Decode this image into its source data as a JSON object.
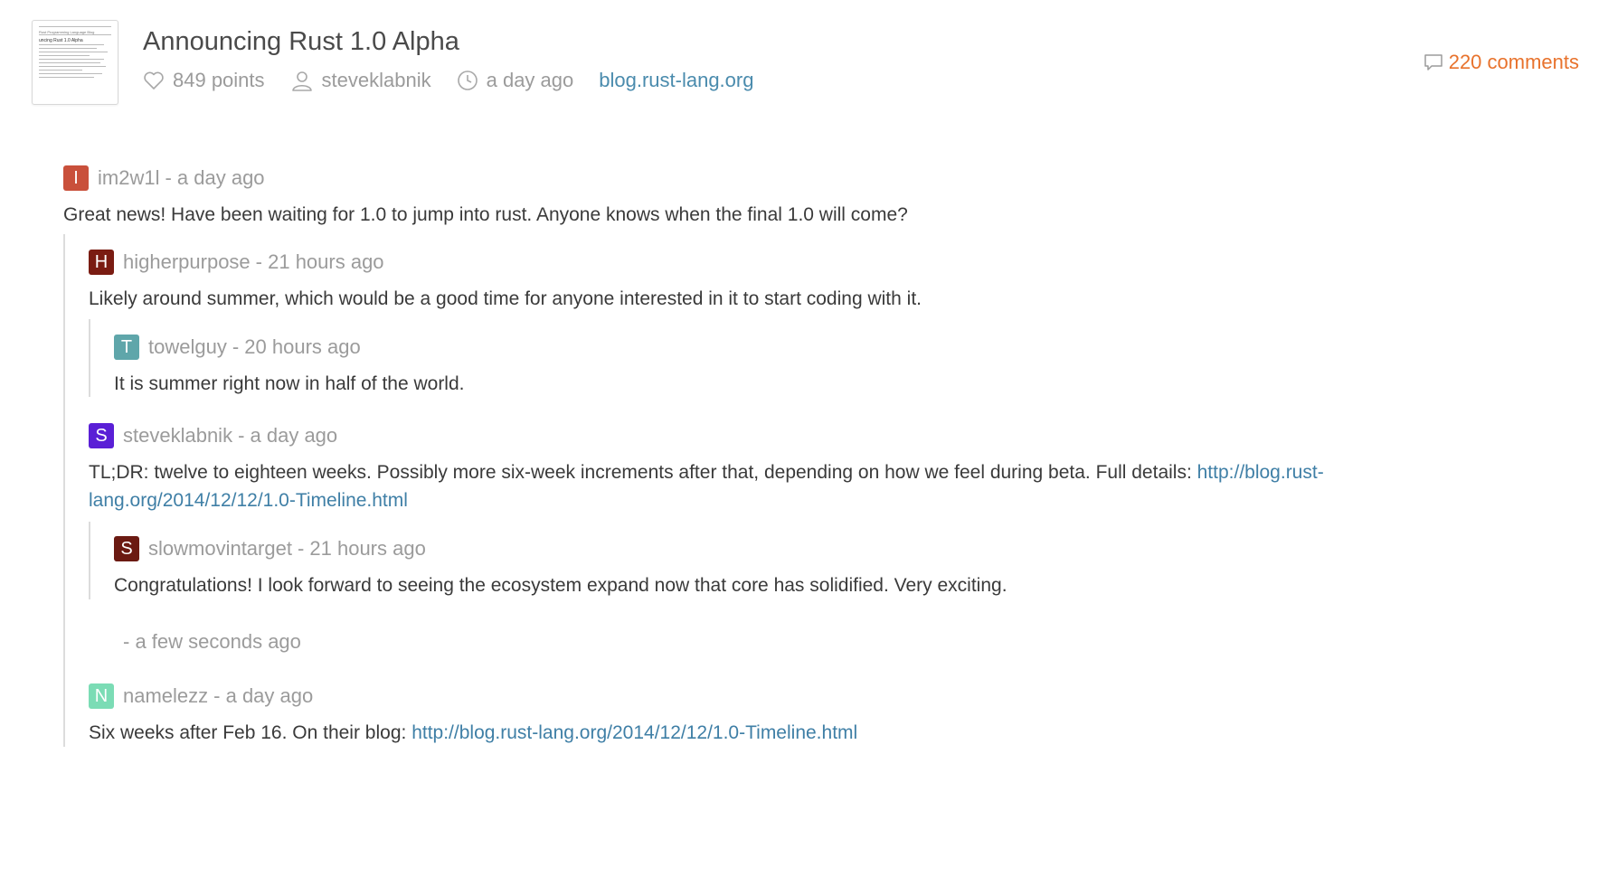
{
  "story": {
    "title": "Announcing Rust 1.0 Alpha",
    "points": "849 points",
    "author": "steveklabnik",
    "time": "a day ago",
    "domain": "blog.rust-lang.org",
    "comments": "220 comments"
  },
  "thumbnail": {
    "header": "Rust Programming Language Blog",
    "title": "uncing Rust 1.0 Alpha"
  },
  "comments": [
    {
      "initial": "I",
      "color": "#c9503b",
      "user": "im2w1l",
      "time": "- a day ago",
      "text": "Great news! Have been waiting for 1.0 to jump into rust. Anyone knows when the final 1.0 will come?"
    },
    {
      "initial": "H",
      "color": "#7a1c12",
      "user": "higherpurpose",
      "time": "- 21 hours ago",
      "text": "Likely around summer, which would be a good time for anyone interested in it to start coding with it."
    },
    {
      "initial": "T",
      "color": "#5fa6aa",
      "user": "towelguy",
      "time": "- 20 hours ago",
      "text": "It is summer right now in half of the world."
    },
    {
      "initial": "S",
      "color": "#5a1fd6",
      "user": "steveklabnik",
      "time": "- a day ago",
      "text": "TL;DR: twelve to eighteen weeks. Possibly more six-week increments after that, depending on how we feel during beta. Full details: ",
      "link": "http://blog.rust-lang.org/2014/12/12/1.0-Timeline.html",
      "link_line1": "http://blog.rust-",
      "link_line2": "lang.org/2014/12/12/1.0-Timeline.html"
    },
    {
      "initial": "S",
      "color": "#6b1a12",
      "user": "slowmovintarget",
      "time": "- 21 hours ago",
      "text": "Congratulations! I look forward to seeing the ecosystem expand now that core has solidified. Very exciting."
    },
    {
      "time": "- a few seconds ago"
    },
    {
      "initial": "N",
      "color": "#7bdcb5",
      "user": "namelezz",
      "time": "- a day ago",
      "text": "Six weeks after Feb 16. On their blog: ",
      "link": "http://blog.rust-lang.org/2014/12/12/1.0-Timeline.html"
    }
  ],
  "colors": {
    "link": "#4a8bad",
    "accent": "#e8722c",
    "meta": "#9b9b9b"
  }
}
